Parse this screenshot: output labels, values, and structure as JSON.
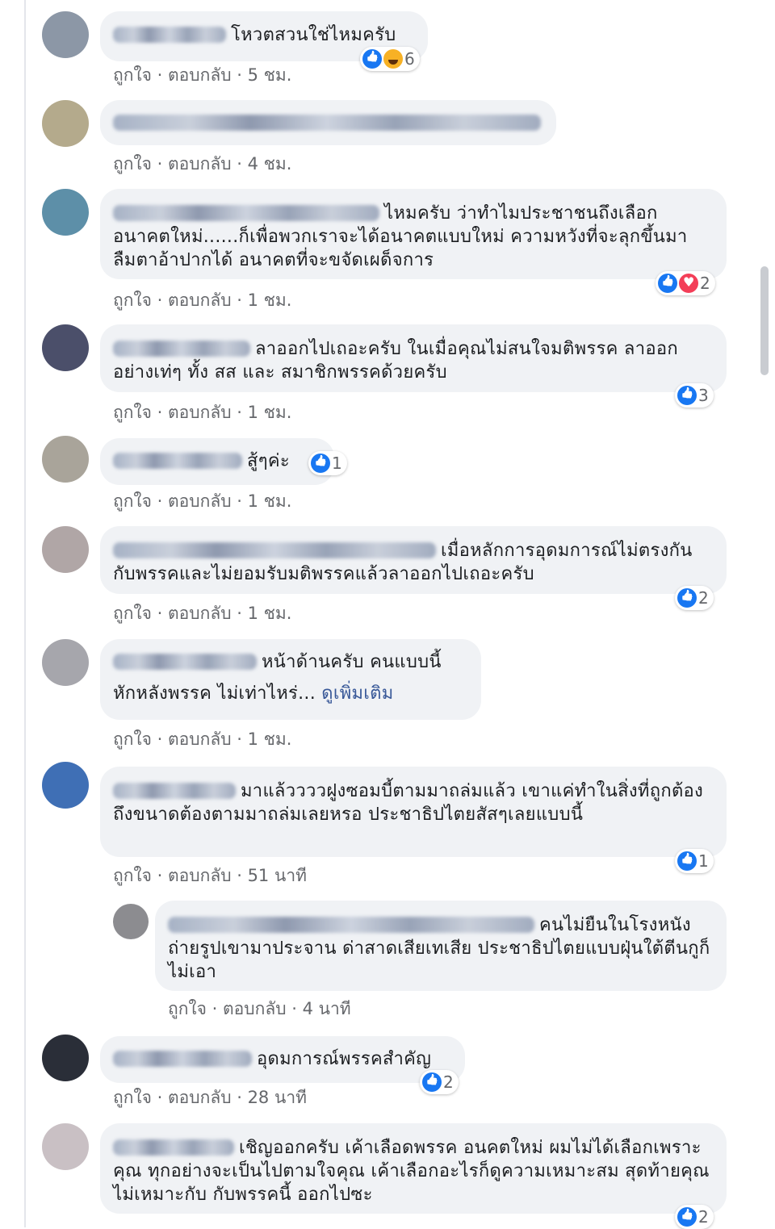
{
  "ui": {
    "like": "ถูกใจ",
    "reply": "ตอบกลับ",
    "sep": " · "
  },
  "comments": [
    {
      "text": "โหวตสวนใช่ไหมครับ",
      "time": "5 ชม.",
      "reaction_count": "6",
      "reactions": [
        "like-icon",
        "haha-icon"
      ]
    },
    {
      "text": "",
      "time": "4 ชม."
    },
    {
      "text": "ไหมครับ ว่าทำไมประชาชนถึงเลือกอนาคตใหม่......ก็เพื่อพวกเราจะได้อนาคตแบบใหม่ ความหวังที่จะลุกขึ้นมาลืมตาอ้าปากได้ อนาคตที่จะขจัดเผด็จการ",
      "time": "1 ชม.",
      "reaction_count": "2",
      "reactions": [
        "like-icon",
        "love-icon"
      ]
    },
    {
      "text": "ลาออกไปเถอะครับ ในเมื่อคุณไม่สนใจมติพรรค ลาออกอย่างเท่ๆ ทั้ง สส และ สมาชิกพรรคด้วยครับ",
      "time": "1 ชม.",
      "reaction_count": "3",
      "reactions": [
        "like-icon"
      ]
    },
    {
      "text": "สู้ๆค่ะ",
      "time": "1 ชม.",
      "reaction_count": "1",
      "reactions": [
        "like-icon"
      ]
    },
    {
      "text": "เมื่อหลักการอุดมการณ์ไม่ตรงกันกับพรรคและไม่ยอมรับมติพรรคแล้วลาออกไปเถอะครับ",
      "time": "1 ชม.",
      "reaction_count": "2",
      "reactions": [
        "like-icon"
      ]
    },
    {
      "text": "หน้าด้านครับ คนแบบนี้",
      "text2": "หักหลังพรรค ไม่เท่าไหร่...",
      "see_more": "ดูเพิ่มเติม",
      "time": "1 ชม."
    },
    {
      "text": "มาแล้ววววฝูงซอมบี้ตามมาถล่มแล้ว เขาแค่ทำในสิ่งที่ถูกต้อง ถึงขนาดต้องตามมาถล่มเลยหรอ ประชาธิปไตยสัสๆเลยแบบนี้",
      "time": "51 นาที",
      "reaction_count": "1",
      "reactions": [
        "like-icon"
      ]
    },
    {
      "text": "คนไม่ยืนในโรงหนังถ่ายรูปเขามาประจาน ด่าสาดเสียเทเสีย ประชาธิปไตยแบบฝุ่นใต้ตีนกูก็ไม่เอา",
      "time": "4 นาที"
    },
    {
      "text": "อุดมการณ์พรรคสำคัญ",
      "time": "28 นาที",
      "reaction_count": "2",
      "reactions": [
        "like-icon"
      ]
    },
    {
      "text": "เชิญออกครับ เค้าเลือดพรรค อนคตใหม่ ผมไม่ได้เลือกเพราะคุณ ทุกอย่างจะเป็นไปตามใจคุณ เค้าเลือกอะไรก็ดูความเหมาะสม สุดท้ายคุณไม่เหมาะกับ กับพรรคนี้ ออกไปซะ",
      "reaction_count": "2",
      "reactions": [
        "like-icon"
      ]
    }
  ],
  "colors": {
    "bubble": "#f0f2f5",
    "meta": "#65676b",
    "like": "#1877f2",
    "love": "#f33e58",
    "haha": "#f7b125",
    "link": "#385898"
  }
}
